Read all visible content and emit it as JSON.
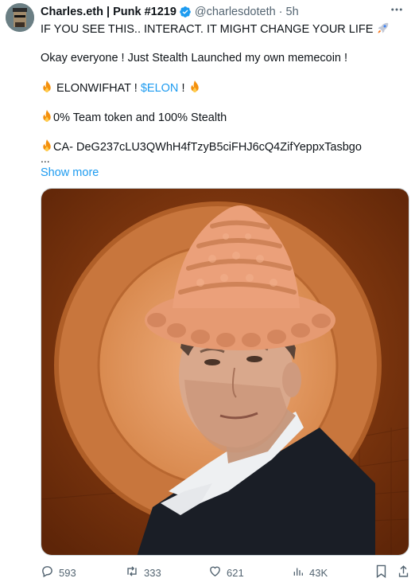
{
  "tweet": {
    "display_name": "Charles.eth | Punk #1219",
    "handle": "@charlesdoteth",
    "separator": "·",
    "time": "5h",
    "line1": "IF YOU SEE THIS.. INTERACT. IT MIGHT CHANGE YOUR LIFE",
    "line2": "Okay everyone ! Just Stealth Launched my own memecoin !",
    "line3_prefix": "ELONWIFHAT !",
    "line3_cashtag": "$ELON",
    "line3_suffix": "!",
    "line4": "0% Team token and 100% Stealth",
    "line5": "CA- DeG237cLU3QWhH4fTzyB5ciFHJ6cQ4ZifYeppxTasbgo",
    "ellipsis": "...",
    "show_more": "Show more"
  },
  "actions": {
    "replies": "593",
    "reposts": "333",
    "likes": "621",
    "views": "43K"
  },
  "colors": {
    "link": "#1d9bf0",
    "muted": "#536471",
    "media_bg": "#7a3510",
    "coin_outer": "#c8763d",
    "coin_inner": "#e8a36e"
  }
}
